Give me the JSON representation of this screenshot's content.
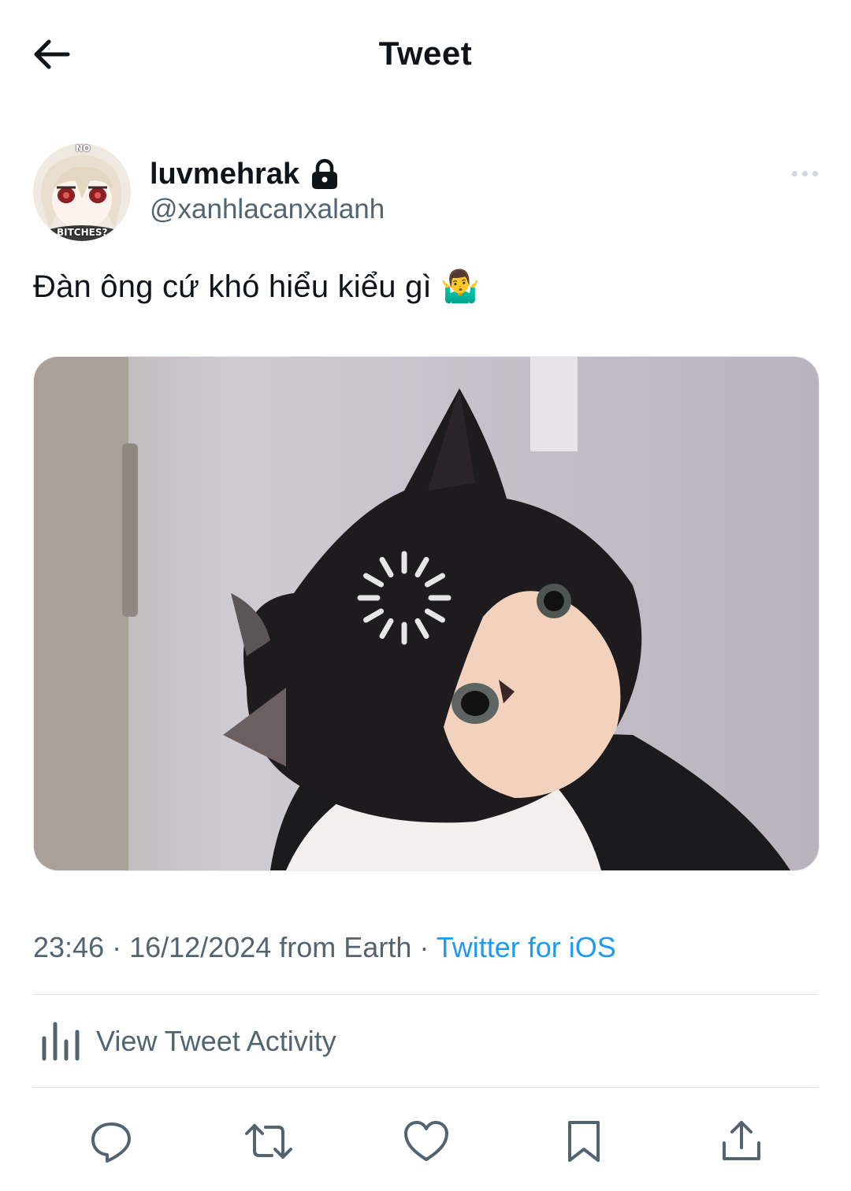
{
  "header": {
    "title": "Tweet",
    "back_icon": "arrow-left-icon"
  },
  "author": {
    "display_name": "luvmehrak",
    "handle": "@xanhlacanxalanh",
    "protected_icon": "lock-icon",
    "avatar_texts": [
      "NO",
      "BITCHES?"
    ]
  },
  "tweet": {
    "text": "Đàn ông cứ khó hiểu kiểu gì 🤷‍♂️",
    "media": {
      "description_icon": "loading-spinner-icon"
    }
  },
  "meta": {
    "time": "23:46",
    "separator": " · ",
    "date": "16/12/2024",
    "location": "from Earth",
    "source": "Twitter for iOS"
  },
  "activity": {
    "label": "View Tweet Activity",
    "icon": "bar-chart-icon"
  },
  "actions": [
    {
      "name": "reply",
      "icon": "reply-icon"
    },
    {
      "name": "retweet",
      "icon": "retweet-icon"
    },
    {
      "name": "like",
      "icon": "heart-icon"
    },
    {
      "name": "bookmark",
      "icon": "bookmark-icon"
    },
    {
      "name": "share",
      "icon": "share-icon"
    }
  ],
  "colors": {
    "text": "#0f1419",
    "secondary": "#536471",
    "link": "#1d9bf0",
    "divider": "#dbe2e7"
  }
}
